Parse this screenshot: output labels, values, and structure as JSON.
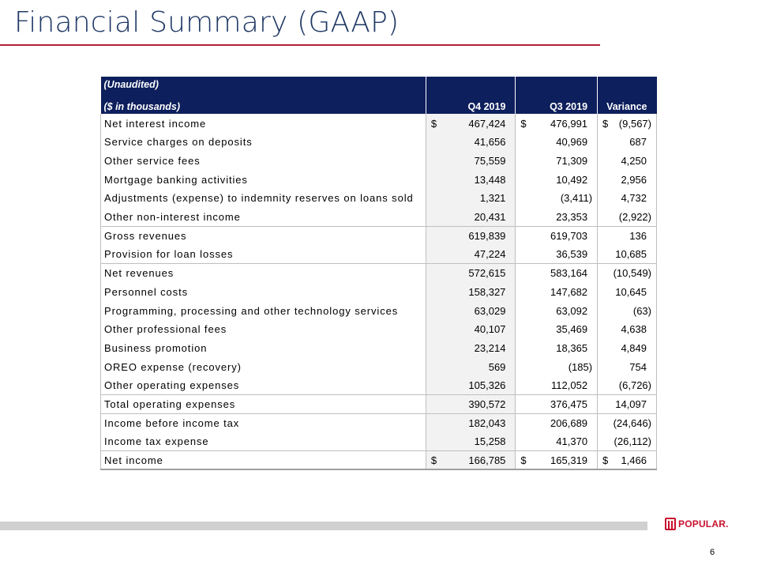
{
  "title": "Financial Summary (GAAP)",
  "table": {
    "header": {
      "unaudited": "(Unaudited)",
      "units": "($ in thousands)",
      "columns": [
        "Q4 2019",
        "Q3 2019",
        "Variance"
      ]
    },
    "rows": [
      {
        "label": "Net interest income",
        "q4": "467,424",
        "q3": "476,991",
        "var": "(9,567)",
        "currency": "$"
      },
      {
        "label": "Service charges on deposits",
        "q4": "41,656",
        "q3": "40,969",
        "var": "687"
      },
      {
        "label": "Other service fees",
        "q4": "75,559",
        "q3": "71,309",
        "var": "4,250"
      },
      {
        "label": "Mortgage banking activities",
        "q4": "13,448",
        "q3": "10,492",
        "var": "2,956"
      },
      {
        "label": "Adjustments (expense) to indemnity reserves on loans sold",
        "q4": "1,321",
        "q3": "(3,411)",
        "var": "4,732"
      },
      {
        "label": "Other non-interest income",
        "q4": "20,431",
        "q3": "23,353",
        "var": "(2,922)"
      },
      {
        "label": "Gross revenues",
        "q4": "619,839",
        "q3": "619,703",
        "var": "136"
      },
      {
        "label": "Provision for loan losses",
        "q4": "47,224",
        "q3": "36,539",
        "var": "10,685"
      },
      {
        "label": "Net revenues",
        "q4": "572,615",
        "q3": "583,164",
        "var": "(10,549)"
      },
      {
        "label": "Personnel costs",
        "q4": "158,327",
        "q3": "147,682",
        "var": "10,645"
      },
      {
        "label": "Programming, processing and other technology services",
        "q4": "63,029",
        "q3": "63,092",
        "var": "(63)"
      },
      {
        "label": "Other professional fees",
        "q4": "40,107",
        "q3": "35,469",
        "var": "4,638"
      },
      {
        "label": "Business promotion",
        "q4": "23,214",
        "q3": "18,365",
        "var": "4,849"
      },
      {
        "label": "OREO expense (recovery)",
        "q4": "569",
        "q3": "(185)",
        "var": "754"
      },
      {
        "label": "Other operating expenses",
        "q4": "105,326",
        "q3": "112,052",
        "var": "(6,726)"
      },
      {
        "label": "Total operating expenses",
        "q4": "390,572",
        "q3": "376,475",
        "var": "14,097"
      },
      {
        "label": "Income before income tax",
        "q4": "182,043",
        "q3": "206,689",
        "var": "(24,646)"
      },
      {
        "label": "Income tax expense",
        "q4": "15,258",
        "q3": "41,370",
        "var": "(26,112)"
      },
      {
        "label": "Net income",
        "q4": "166,785",
        "q3": "165,319",
        "var": "1,466",
        "currency": "$"
      }
    ]
  },
  "footer": {
    "logo_text": "POPULAR.",
    "page_number": "6",
    "colors": {
      "brand_red": "#c8102e",
      "header_navy": "#0d1f5c",
      "accent_rule": "#b2223b"
    }
  }
}
